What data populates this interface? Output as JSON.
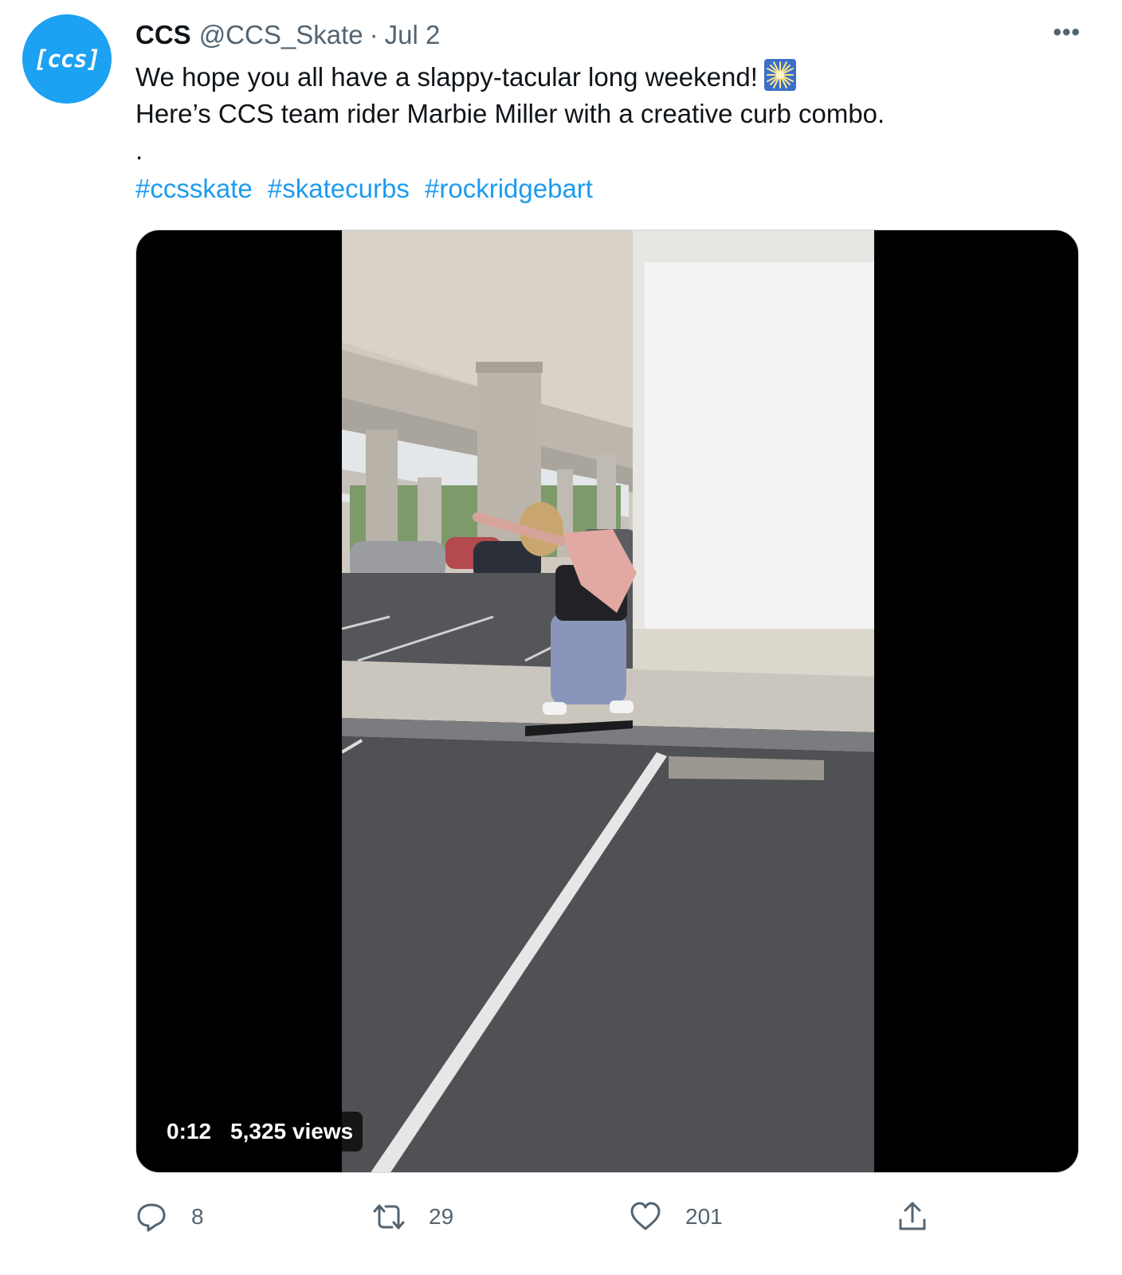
{
  "account": {
    "avatar_text": "[ccs]",
    "name": "CCS",
    "handle": "@CCS_Skate",
    "separator": "·",
    "date": "Jul 2"
  },
  "more_label": "•••",
  "tweet": {
    "line1": "We hope you all have a slappy-tacular long weekend!",
    "line1_emoji": "sparkler-emoji",
    "line2": "Here’s CCS team rider Marbie Miller with a creative curb combo.",
    "line3": ".",
    "hashtags": [
      "#ccsskate",
      "#skatecurbs",
      "#rockridgebart"
    ]
  },
  "video": {
    "duration": "0:12",
    "views": "5,325 views"
  },
  "actions": {
    "reply_count": "8",
    "retweet_count": "29",
    "like_count": "201"
  },
  "colors": {
    "brand_blue": "#1da1f2",
    "link_blue": "#1d9bf0",
    "muted": "#536471",
    "text": "#0f1419"
  },
  "icons": [
    "reply-icon",
    "retweet-icon",
    "like-icon",
    "share-icon",
    "more-icon"
  ]
}
